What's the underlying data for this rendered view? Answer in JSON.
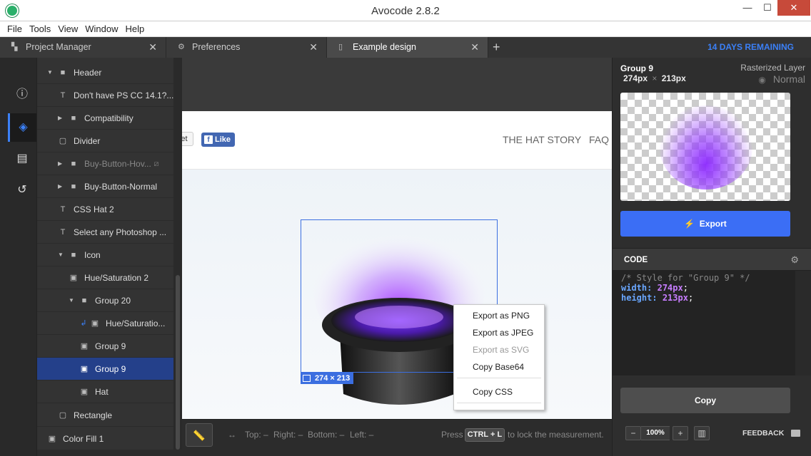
{
  "window": {
    "title": "Avocode 2.8.2",
    "minimize": "—",
    "maximize": "☐",
    "close": "✕"
  },
  "menu": [
    "File",
    "Tools",
    "View",
    "Window",
    "Help"
  ],
  "tabs": [
    {
      "label": "Project Manager",
      "icon": "layers-icon",
      "glyph": "▚",
      "close": "✕"
    },
    {
      "label": "Preferences",
      "icon": "gear-icon",
      "glyph": "⚙",
      "close": "✕"
    },
    {
      "label": "Example design",
      "icon": "document-icon",
      "glyph": "▯",
      "close": "✕"
    }
  ],
  "tab_add": "+",
  "trial": "14 DAYS REMAINING",
  "rail": [
    {
      "name": "info-icon",
      "glyph": "ⓘ"
    },
    {
      "name": "layers-stack-icon",
      "glyph": "◈"
    },
    {
      "name": "comments-icon",
      "glyph": "▤"
    },
    {
      "name": "history-icon",
      "glyph": "↺"
    }
  ],
  "layers": [
    {
      "label": "Header",
      "kind": "folder"
    },
    {
      "label": "Don't have PS CC 14.1?...",
      "kind": "text"
    },
    {
      "label": "Compatibility",
      "kind": "folder"
    },
    {
      "label": "Divider",
      "kind": "shape"
    },
    {
      "label": "Buy-Button-Hov...",
      "kind": "folder"
    },
    {
      "label": "Buy-Button-Normal",
      "kind": "folder"
    },
    {
      "label": "CSS Hat 2",
      "kind": "text"
    },
    {
      "label": "Select any Photoshop ...",
      "kind": "text"
    },
    {
      "label": "Icon",
      "kind": "folder"
    },
    {
      "label": "Hue/Saturation 2",
      "kind": "image"
    },
    {
      "label": "Group 20",
      "kind": "folder"
    },
    {
      "label": "Hue/Saturatio...",
      "kind": "image"
    },
    {
      "label": "Group 9",
      "kind": "image"
    },
    {
      "label": "Group 9",
      "kind": "image",
      "selected": true
    },
    {
      "label": "Hat",
      "kind": "image"
    },
    {
      "label": "Rectangle",
      "kind": "shape"
    },
    {
      "label": "Color Fill 1",
      "kind": "image"
    }
  ],
  "canvas": {
    "tweet": "et",
    "fb_like": "Like",
    "fb_f": "f",
    "nav": [
      "THE HAT STORY",
      "FAQ"
    ],
    "selection_size": "274 × 213",
    "context_menu": [
      {
        "label": "Export as PNG",
        "enabled": true
      },
      {
        "label": "Export as JPEG",
        "enabled": true
      },
      {
        "label": "Export as SVG",
        "enabled": false
      },
      {
        "label": "Copy Base64",
        "enabled": true
      },
      {
        "label": "Copy CSS",
        "enabled": true
      }
    ]
  },
  "bottombar": {
    "arrows": "↔",
    "top": "Top: –",
    "right": "Right: –",
    "bottom": "Bottom: –",
    "left": "Left: –",
    "press": "Press",
    "shortcut": "CTRL + L",
    "hint": "to lock the measurement."
  },
  "inspector": {
    "name": "Group 9",
    "width": "274px",
    "times": "×",
    "height": "213px",
    "layer_type": "Rasterized Layer",
    "blend": "Normal",
    "eye_glyph": "◉",
    "export_label": "Export",
    "export_glyph": "⚡",
    "code_label": "CODE",
    "gear_glyph": "⚙",
    "code_comment": "/* Style for \"Group 9\" */",
    "code_width_prop": "width:",
    "code_width_val": "274px",
    "code_height_prop": "height:",
    "code_height_val": "213px",
    "semicolon": ";",
    "copy_label": "Copy",
    "zoom_minus": "−",
    "zoom": "100%",
    "zoom_plus": "+",
    "barcode_glyph": "▥",
    "feedback": "FEEDBACK"
  },
  "colors": {
    "accent": "#3b6ef5",
    "selection": "#24408a",
    "trial": "#3b80f7",
    "code_prop": "#6aa7ff",
    "code_value": "#c77dff"
  }
}
